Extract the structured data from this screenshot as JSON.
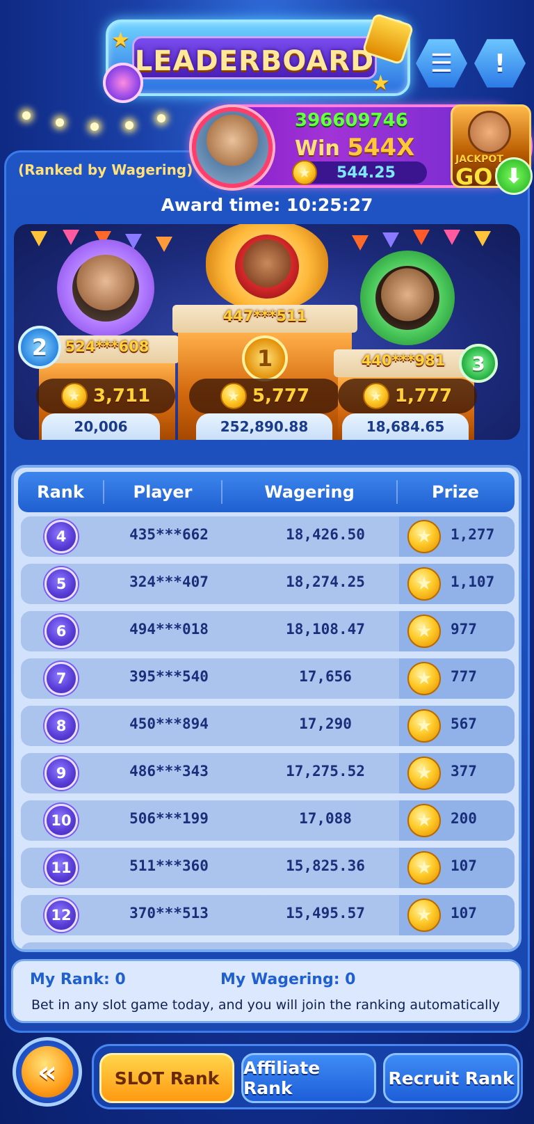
{
  "header": {
    "title": "LEADERBOARD",
    "calendar_icon": "calendar-icon",
    "info_icon": "exclamation-icon"
  },
  "ticker": {
    "player_id": "396609746",
    "win_label": "Win",
    "multiplier": "544X",
    "amount": "544.25",
    "jackpot_label": "JACKPOT",
    "jackpot_go": "GO!"
  },
  "ranked_by": "(Ranked by Wagering)",
  "award_time": "Award time: 10:25:27",
  "podium": [
    {
      "rank": "1",
      "player": "447***511",
      "prize": "5,777",
      "wagering": "252,890.88"
    },
    {
      "rank": "2",
      "player": "524***608",
      "prize": "3,711",
      "wagering": "20,006"
    },
    {
      "rank": "3",
      "player": "440***981",
      "prize": "1,777",
      "wagering": "18,684.65"
    }
  ],
  "table": {
    "headers": {
      "rank": "Rank",
      "player": "Player",
      "wagering": "Wagering",
      "prize": "Prize"
    },
    "rows": [
      {
        "rank": "4",
        "player": "435***662",
        "wagering": "18,426.50",
        "prize": "1,277"
      },
      {
        "rank": "5",
        "player": "324***407",
        "wagering": "18,274.25",
        "prize": "1,107"
      },
      {
        "rank": "6",
        "player": "494***018",
        "wagering": "18,108.47",
        "prize": "977"
      },
      {
        "rank": "7",
        "player": "395***540",
        "wagering": "17,656",
        "prize": "777"
      },
      {
        "rank": "8",
        "player": "450***894",
        "wagering": "17,290",
        "prize": "567"
      },
      {
        "rank": "9",
        "player": "486***343",
        "wagering": "17,275.52",
        "prize": "377"
      },
      {
        "rank": "10",
        "player": "506***199",
        "wagering": "17,088",
        "prize": "200"
      },
      {
        "rank": "11",
        "player": "511***360",
        "wagering": "15,825.36",
        "prize": "107"
      },
      {
        "rank": "12",
        "player": "370***513",
        "wagering": "15,495.57",
        "prize": "107"
      }
    ]
  },
  "my": {
    "rank": "My Rank: 0",
    "wagering": "My Wagering: 0",
    "note": "Bet in any slot game today, and you will join the ranking automatically"
  },
  "nav": {
    "back_icon": "double-chevron-left-icon",
    "tabs": [
      {
        "label": "SLOT Rank",
        "active": true
      },
      {
        "label": "Affiliate Rank",
        "active": false
      },
      {
        "label": "Recruit Rank",
        "active": false
      }
    ]
  },
  "colors": {
    "gold": "#ffd23a",
    "accent_blue": "#1f5fd0",
    "rank_purple": "#5a3ed8",
    "active_tab": "#ff9a12"
  }
}
